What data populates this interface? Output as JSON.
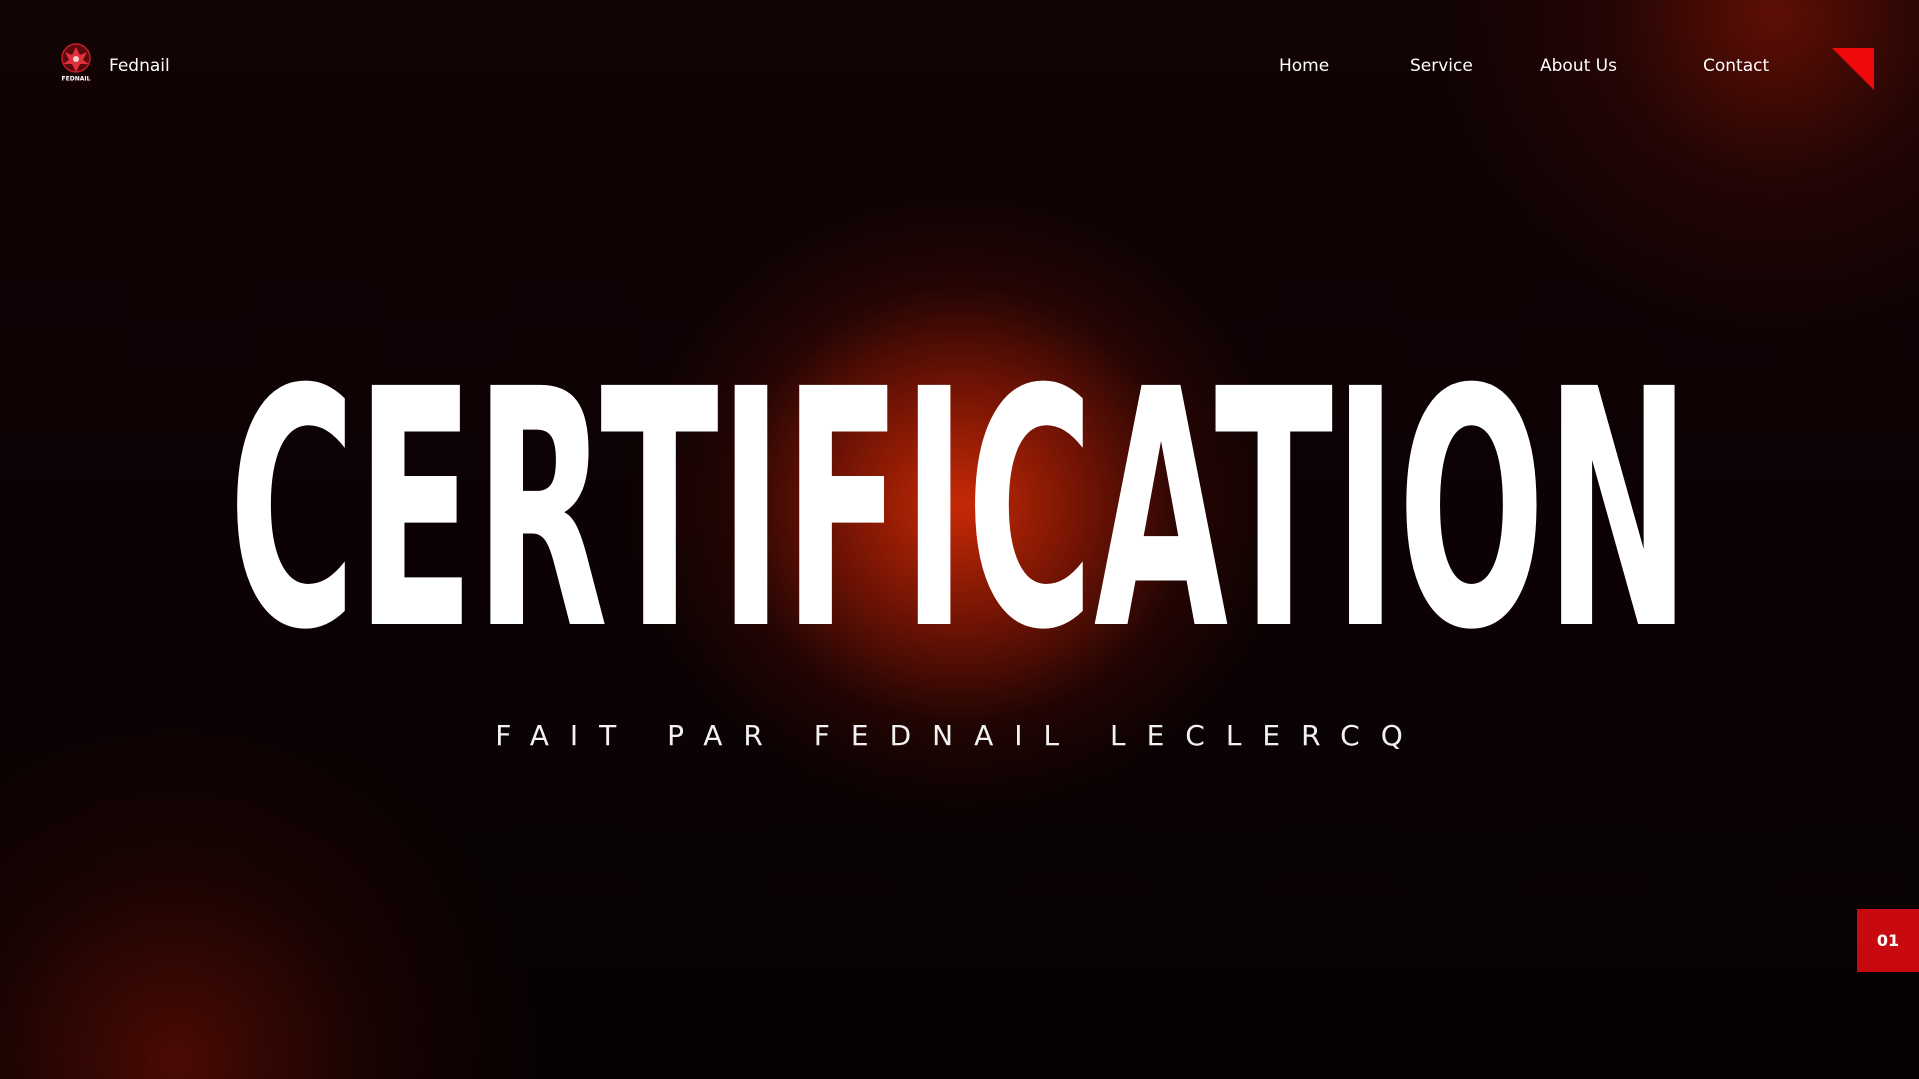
{
  "header": {
    "brand_name": "Fednail",
    "logo_text": "FEDNAIL",
    "nav": [
      {
        "label": "Home"
      },
      {
        "label": "Service"
      },
      {
        "label": "About Us"
      },
      {
        "label": "Contact"
      }
    ]
  },
  "hero": {
    "title": "CERTIFICATION",
    "subtitle": "FAIT PAR FEDNAIL LECLERCQ"
  },
  "slide_indicator": "01",
  "colors": {
    "background": "#0a0203",
    "glow": "#d72d05",
    "accent": "#c80a10",
    "text": "#ffffff"
  },
  "icons": {
    "logo": "phoenix-emblem-icon",
    "corner": "red-triangle-icon"
  }
}
